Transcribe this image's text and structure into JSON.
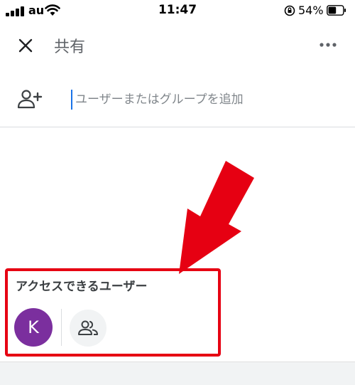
{
  "status_bar": {
    "carrier": "au",
    "time": "11:47",
    "battery_percent": "54%",
    "battery_level": 0.54
  },
  "header": {
    "title": "共有",
    "close_icon": "close-icon",
    "more_icon": "more-horizontal-icon"
  },
  "add_people": {
    "icon": "add-person-icon",
    "placeholder": "ユーザーまたはグループを追加"
  },
  "access": {
    "title": "アクセスできるユーザー",
    "avatar_initial": "K",
    "avatar_color": "#7b2f9e",
    "people_icon": "people-icon"
  },
  "annotation": {
    "color": "#e60012"
  }
}
